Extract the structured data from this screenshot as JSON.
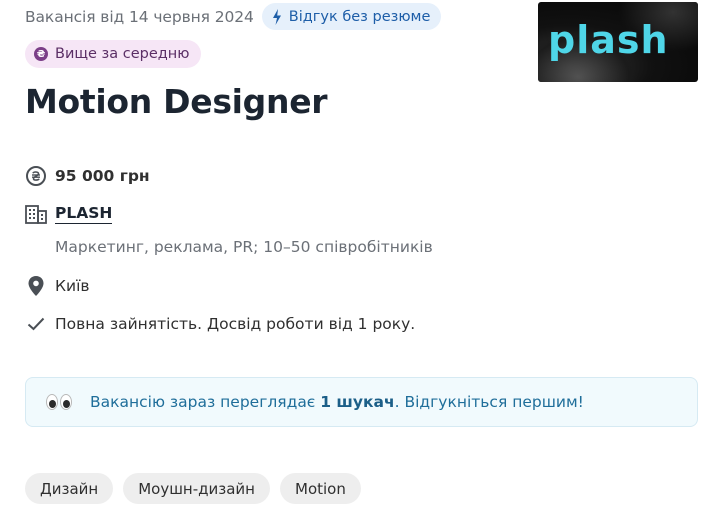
{
  "header": {
    "date_text": "Вакансія від 14 червня 2024",
    "no_resume_badge": "Відгук без резюме",
    "salary_badge": "Вище за середню"
  },
  "logo": {
    "text": "plash"
  },
  "job": {
    "title": "Motion Designer",
    "salary": "95 000 грн",
    "company_name": "PLASH",
    "company_description": "Маркетинг, реклама, PR; 10–50 співробітників",
    "city": "Київ",
    "employment": "Повна зайнятість. Досвід роботи від 1 року."
  },
  "notice": {
    "prefix": "Вакансію зараз переглядає ",
    "highlight": "1 шукач",
    "suffix": ". Відгукніться першим!"
  },
  "tags": [
    "Дизайн",
    "Моушн-дизайн",
    "Motion"
  ],
  "colors": {
    "no_resume_bg": "#e6f0fb",
    "salary_badge_bg": "#f6e6f6",
    "notice_bg": "#f1fafd",
    "logo_text": "#4fd6e8"
  }
}
